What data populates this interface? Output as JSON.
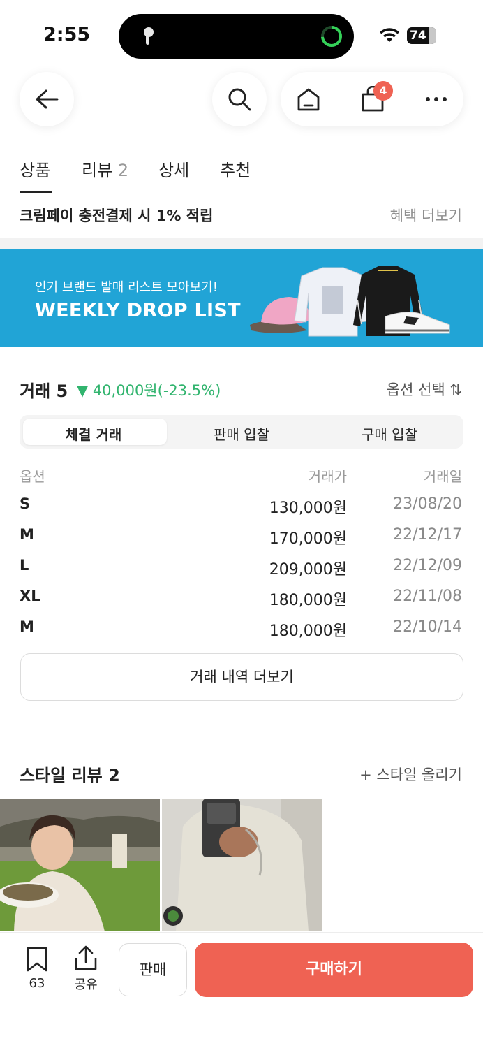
{
  "status_bar": {
    "time": "2:55",
    "battery": "74"
  },
  "nav": {
    "cart_count": "4"
  },
  "tabs": [
    {
      "label": "상품",
      "count": ""
    },
    {
      "label": "리뷰",
      "count": "2"
    },
    {
      "label": "상세",
      "count": ""
    },
    {
      "label": "추천",
      "count": ""
    }
  ],
  "promo": {
    "text": "크림페이 충전결제 시 1% 적립",
    "more": "혜택 더보기"
  },
  "banner": {
    "subtitle": "인기 브랜드 발매 리스트 모아보기!",
    "title": "WEEKLY DROP LIST"
  },
  "trade": {
    "title": "거래 5",
    "change": "▼ 40,000원(-23.5%)",
    "option_select": "옵션 선택 ⇅",
    "segments": [
      "체결 거래",
      "판매 입찰",
      "구매 입찰"
    ],
    "columns": {
      "option": "옵션",
      "price": "거래가",
      "date": "거래일"
    },
    "rows": [
      {
        "option": "S",
        "price": "130,000원",
        "date": "23/08/20"
      },
      {
        "option": "M",
        "price": "170,000원",
        "date": "22/12/17"
      },
      {
        "option": "L",
        "price": "209,000원",
        "date": "22/12/09"
      },
      {
        "option": "XL",
        "price": "180,000원",
        "date": "22/11/08"
      },
      {
        "option": "M",
        "price": "180,000원",
        "date": "22/10/14"
      }
    ],
    "more_label": "거래 내역 더보기"
  },
  "style_review": {
    "title": "스타일 리뷰 2",
    "upload": "+ 스타일 올리기"
  },
  "bottom": {
    "bookmark_count": "63",
    "share_label": "공유",
    "sell_label": "판매",
    "buy_label": "구매하기"
  },
  "colors": {
    "accent": "#ef6253",
    "banner": "#21a4d6",
    "down": "#31b46e"
  }
}
